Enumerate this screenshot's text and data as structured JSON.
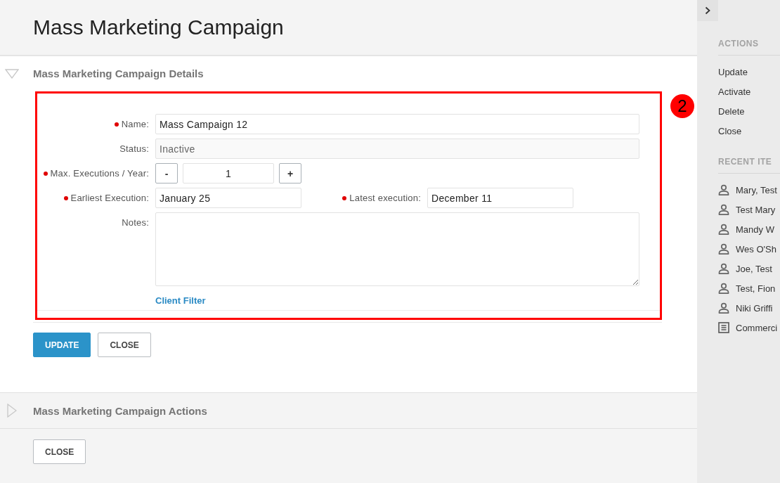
{
  "header": {
    "title": "Mass Marketing Campaign"
  },
  "sections": [
    {
      "title": "Mass Marketing Campaign Details",
      "expanded": true,
      "form": {
        "fields": [
          {
            "kind": "text",
            "label": "Name:",
            "required": true,
            "value": "Mass Campaign 12"
          },
          {
            "kind": "readonly",
            "label": "Status:",
            "required": false,
            "value": "Inactive"
          },
          {
            "kind": "stepper",
            "label": "Max. Executions / Year:",
            "required": true,
            "value": "1",
            "decrement": "-",
            "increment": "+"
          },
          {
            "kind": "pair",
            "label": "Earliest Execution:",
            "required": true,
            "value": "January 25",
            "second": {
              "label": "Latest execution:",
              "required": true,
              "value": "December 11"
            }
          },
          {
            "kind": "textarea",
            "label": "Notes:",
            "required": false
          }
        ],
        "link": "Client Filter"
      },
      "buttons": [
        {
          "label": "UPDATE",
          "kind": "primary"
        },
        {
          "label": "CLOSE",
          "kind": "secondary"
        }
      ]
    },
    {
      "title": "Mass Marketing Campaign Actions",
      "expanded": false
    }
  ],
  "footer_buttons": [
    {
      "label": "CLOSE",
      "kind": "secondary"
    }
  ],
  "annotation": {
    "label": "2"
  },
  "sidebar": {
    "actions": {
      "heading": "ACTIONS",
      "items": [
        "Update",
        "Activate",
        "Delete",
        "Close"
      ]
    },
    "recent": {
      "heading": "RECENT ITE",
      "items": [
        {
          "label": "Mary, Test",
          "kind": "person"
        },
        {
          "label": "Test Mary",
          "kind": "person"
        },
        {
          "label": "Mandy W",
          "kind": "person"
        },
        {
          "label": "Wes O'Sh",
          "kind": "person"
        },
        {
          "label": "Joe, Test",
          "kind": "person"
        },
        {
          "label": "Test, Fion",
          "kind": "person"
        },
        {
          "label": "Niki Griffi",
          "kind": "person"
        },
        {
          "label": "Commerci",
          "kind": "document"
        }
      ]
    }
  }
}
